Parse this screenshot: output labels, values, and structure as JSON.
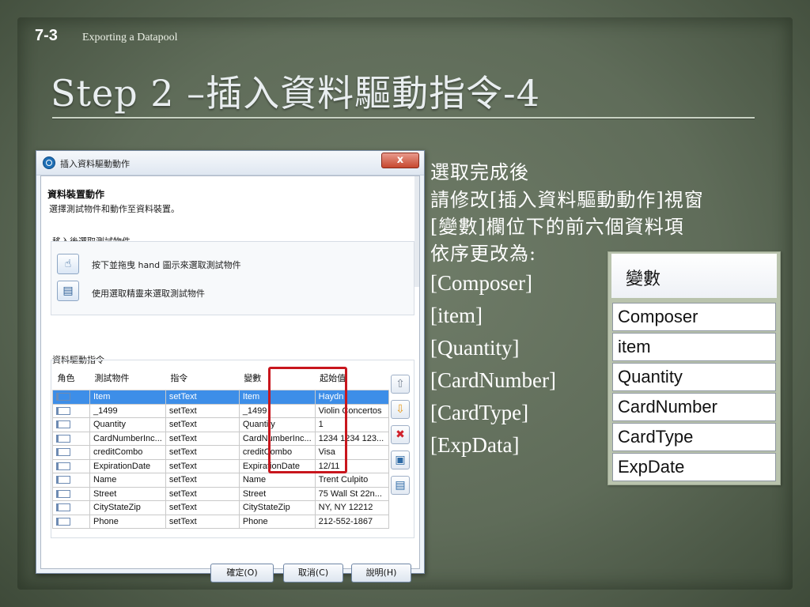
{
  "slide": {
    "number": "7-3",
    "section": "Exporting a Datapool",
    "title": "Step 2 –插入資料驅動指令-4"
  },
  "dialog": {
    "title": "插入資料驅動動作",
    "close_label": "x",
    "heading": "資料裝置動作",
    "description": "選擇測試物件和動作至資料裝置。",
    "group1_label": "移入後選取測試物件",
    "option1_text": "按下並拖曳 hand 圖示來選取測試物件",
    "option2_text": "使用選取精靈來選取測試物件",
    "group2_label": "資料驅動指令",
    "columns": [
      "角色",
      "測試物件",
      "指令",
      "變數",
      "起始值"
    ],
    "rows": [
      {
        "object": "Item",
        "command": "setText",
        "variable": "Item",
        "value": "Haydn",
        "selected": true
      },
      {
        "object": "_1499",
        "command": "setText",
        "variable": "_1499",
        "value": "Violin Concertos",
        "selected": false
      },
      {
        "object": "Quantity",
        "command": "setText",
        "variable": "Quantity",
        "value": "1",
        "selected": false
      },
      {
        "object": "CardNumberInc...",
        "command": "setText",
        "variable": "CardNumberInc...",
        "value": "1234 1234 123...",
        "selected": false
      },
      {
        "object": "creditCombo",
        "command": "setText",
        "variable": "creditCombo",
        "value": "Visa",
        "selected": false
      },
      {
        "object": "ExpirationDate",
        "command": "setText",
        "variable": "ExpirationDate",
        "value": "12/11",
        "selected": false
      },
      {
        "object": "Name",
        "command": "setText",
        "variable": "Name",
        "value": "Trent Culpito",
        "selected": false
      },
      {
        "object": "Street",
        "command": "setText",
        "variable": "Street",
        "value": "75 Wall St 22n...",
        "selected": false
      },
      {
        "object": "CityStateZip",
        "command": "setText",
        "variable": "CityStateZip",
        "value": "NY, NY 12212",
        "selected": false
      },
      {
        "object": "Phone",
        "command": "setText",
        "variable": "Phone",
        "value": "212-552-1867",
        "selected": false
      }
    ],
    "ok_label": "確定(O)",
    "cancel_label": "取消(C)",
    "help_label": "說明(H)"
  },
  "instructions": {
    "lines": [
      "選取完成後",
      "請修改[插入資料驅動動作]視窗",
      "[變數]欄位下的前六個資料項",
      "依序更改為:"
    ],
    "names": [
      "[Composer]",
      "[item]",
      "[Quantity]",
      "[CardNumber]",
      "[CardType]",
      "[ExpData]"
    ]
  },
  "inset": {
    "header": "變數",
    "cells": [
      "Composer",
      "item",
      "Quantity",
      "CardNumber",
      "CardType",
      "ExpDate"
    ]
  },
  "colors": {
    "background": "#5d6b57",
    "selection": "#3d8ee8",
    "highlight_box": "#c8161d",
    "text": "#ffffff"
  }
}
